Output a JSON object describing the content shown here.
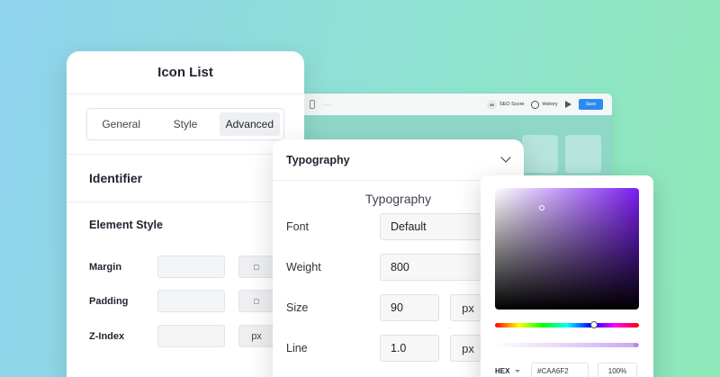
{
  "background_editor": {
    "seo_badge": "95",
    "seo_label": "SEO Score",
    "history_label": "History",
    "save_label": "Save"
  },
  "icon_list": {
    "title": "Icon List",
    "tabs": [
      {
        "label": "General"
      },
      {
        "label": "Style"
      },
      {
        "label": "Advanced",
        "active": true
      }
    ],
    "section_identifier": "Identifier",
    "section_element_style": "Element Style",
    "rows": {
      "margin": "Margin",
      "padding": "Padding",
      "zindex": "Z-Index",
      "zindex_unit": "px"
    }
  },
  "typography": {
    "header": "Typography",
    "subtitle": "Typography",
    "font_label": "Font",
    "font_value": "Default",
    "weight_label": "Weight",
    "weight_value": "800",
    "size_label": "Size",
    "size_value": "90",
    "size_unit": "px",
    "line_label": "Line",
    "line_value": "1.0",
    "line_unit": "px"
  },
  "color_picker": {
    "hex_label": "HEX",
    "hex_value": "#CAA6F2",
    "opacity_value": "100%",
    "accent": "#7a1cf0",
    "selected_color": "#CAA6F2"
  }
}
